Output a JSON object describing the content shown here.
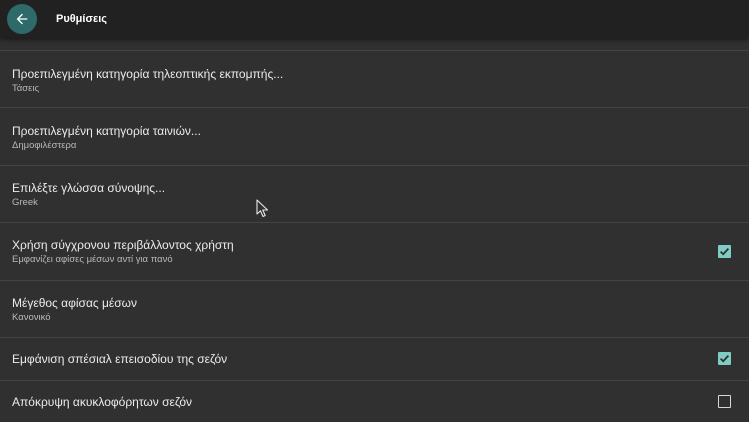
{
  "header": {
    "back_icon": "arrow-left-icon",
    "title": "Ρυθμίσεις"
  },
  "colors": {
    "header_bg": "#212121",
    "page_bg": "#303030",
    "back_button_bg": "#2e6a6a",
    "checkbox_accent": "#80cbc4"
  },
  "settings": [
    {
      "label": "Προεπιλεγμένη κατηγορία τηλεοπτικής εκπομπής...",
      "value": "Τάσεις"
    },
    {
      "label": "Προεπιλεγμένη κατηγορία ταινιών...",
      "value": "Δημοφιλέστερα"
    },
    {
      "label": "Επιλέξτε γλώσσα σύνοψης...",
      "value": "Greek"
    },
    {
      "label": "Χρήση σύγχρονου περιβάλλοντος χρήστη",
      "value": "Εμφανίζει αφίσες μέσων αντί για πανό",
      "checked": true
    },
    {
      "label": "Μέγεθος αφίσας μέσων",
      "value": "Κανονικό"
    },
    {
      "label": "Εμφάνιση σπέσιαλ επεισοδίου της σεζόν",
      "checked": true
    },
    {
      "label": "Απόκρυψη ακυκλοφόρητων σεζόν",
      "checked": false
    }
  ]
}
